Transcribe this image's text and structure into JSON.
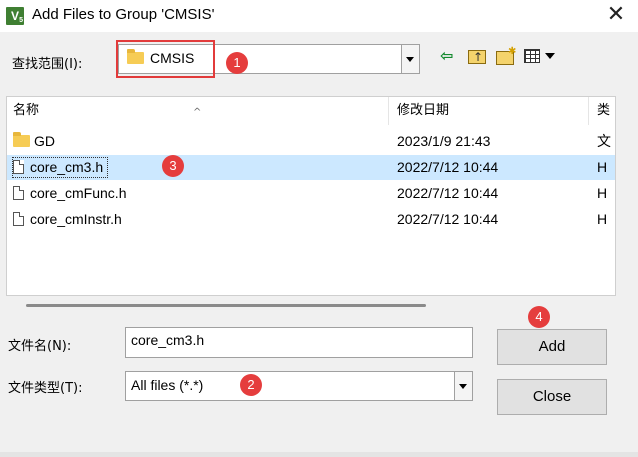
{
  "window": {
    "title": "Add Files to Group 'CMSIS'",
    "app_icon_letter": "V",
    "app_icon_sub": "5",
    "close_glyph": "✕"
  },
  "look_in": {
    "label": "查找范围(I):",
    "value": "CMSIS"
  },
  "toolbar": {
    "back_glyph": "⇦"
  },
  "columns": {
    "name": "名称",
    "modified": "修改日期",
    "type": "类"
  },
  "files": [
    {
      "icon": "folder-icon",
      "name": "GD",
      "modified": "2023/1/9 21:43",
      "type": "文",
      "selected": false
    },
    {
      "icon": "file-icon",
      "name": "core_cm3.h",
      "modified": "2022/7/12 10:44",
      "type": "H",
      "selected": true
    },
    {
      "icon": "file-icon",
      "name": "core_cmFunc.h",
      "modified": "2022/7/12 10:44",
      "type": "H",
      "selected": false
    },
    {
      "icon": "file-icon",
      "name": "core_cmInstr.h",
      "modified": "2022/7/12 10:44",
      "type": "H",
      "selected": false
    }
  ],
  "file_name": {
    "label": "文件名(N):",
    "value": "core_cm3.h"
  },
  "file_type": {
    "label": "文件类型(T):",
    "value": "All files (*.*)"
  },
  "buttons": {
    "add": "Add",
    "close": "Close"
  },
  "annotations": [
    "1",
    "2",
    "3",
    "4"
  ],
  "colors": {
    "annotation": "#e53d3d",
    "selection": "#cce8ff",
    "dialog_bg": "#f0f0f0"
  }
}
